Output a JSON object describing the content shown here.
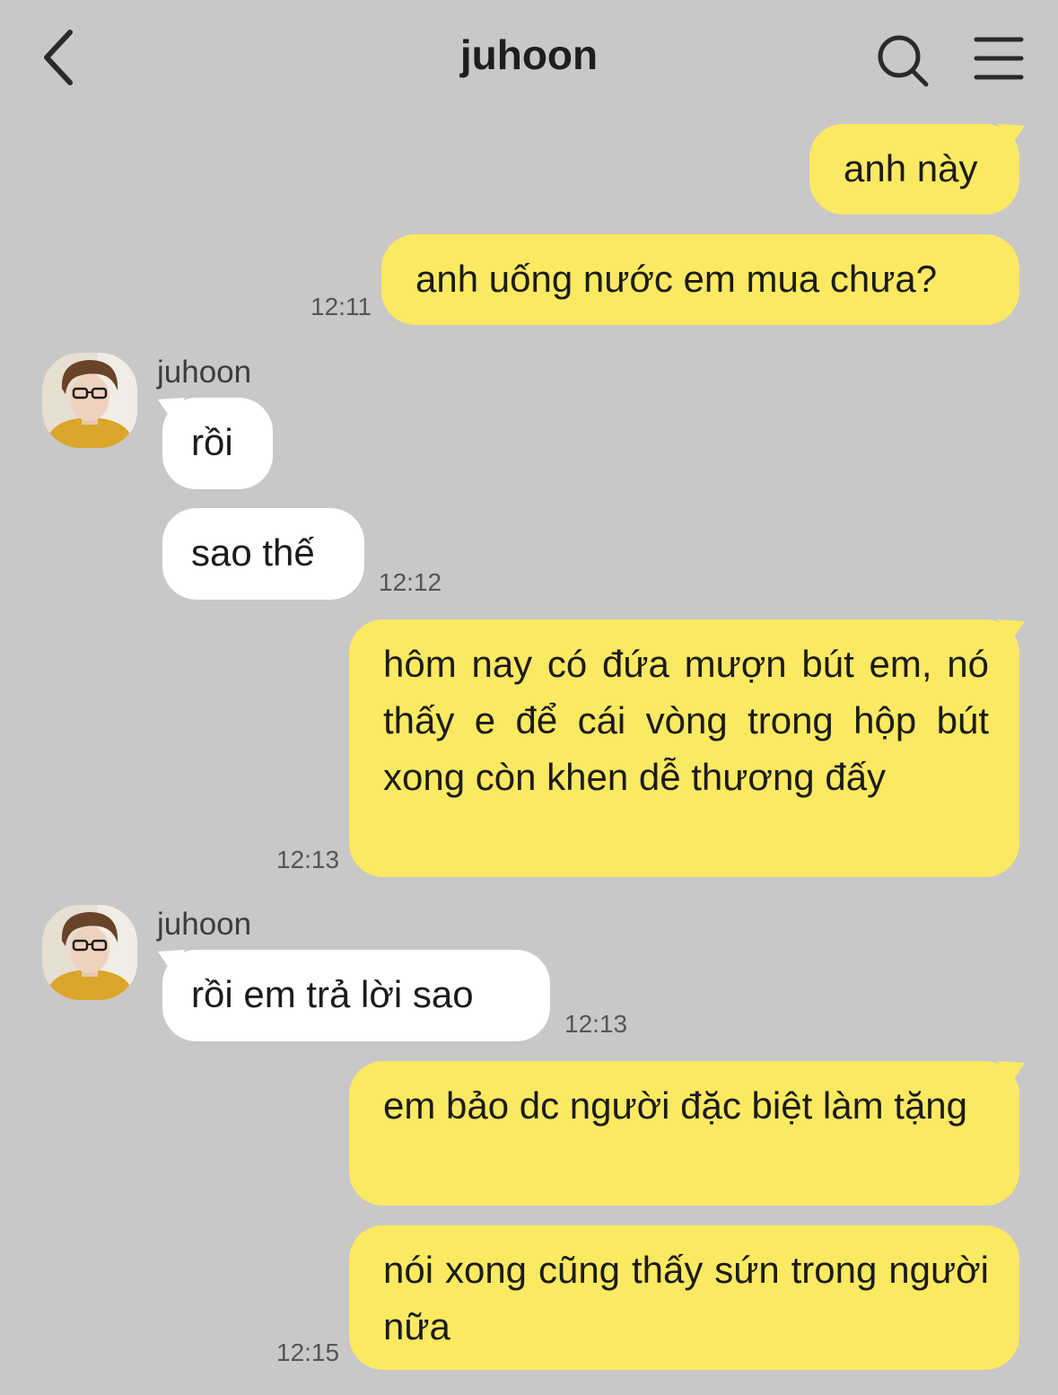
{
  "header": {
    "title": "juhoon",
    "back_icon": "chevron-left-icon",
    "search_icon": "search-icon",
    "menu_icon": "hamburger-menu-icon"
  },
  "colors": {
    "background": "#c8c8c8",
    "my_bubble": "#fbe962",
    "their_bubble": "#ffffff"
  },
  "messages": [
    {
      "from": "me",
      "text": "anh này"
    },
    {
      "from": "me",
      "text": "anh uống nước em mua chưa?",
      "time": "12:11"
    },
    {
      "from": "juhoon",
      "sender": "juhoon",
      "text": "rồi"
    },
    {
      "from": "juhoon",
      "text": "sao thế",
      "time": "12:12"
    },
    {
      "from": "me",
      "text": "hôm nay có đứa mượn bút em, nó thấy e để cái vòng trong hộp bút xong còn khen dễ thương đấy",
      "time": "12:13"
    },
    {
      "from": "juhoon",
      "sender": "juhoon",
      "text": "rồi em trả lời sao",
      "time": "12:13"
    },
    {
      "from": "me",
      "text": "em bảo dc người đặc biệt làm tặng"
    },
    {
      "from": "me",
      "text": "nói xong cũng thấy sứn trong người nữa",
      "time": "12:15"
    }
  ]
}
